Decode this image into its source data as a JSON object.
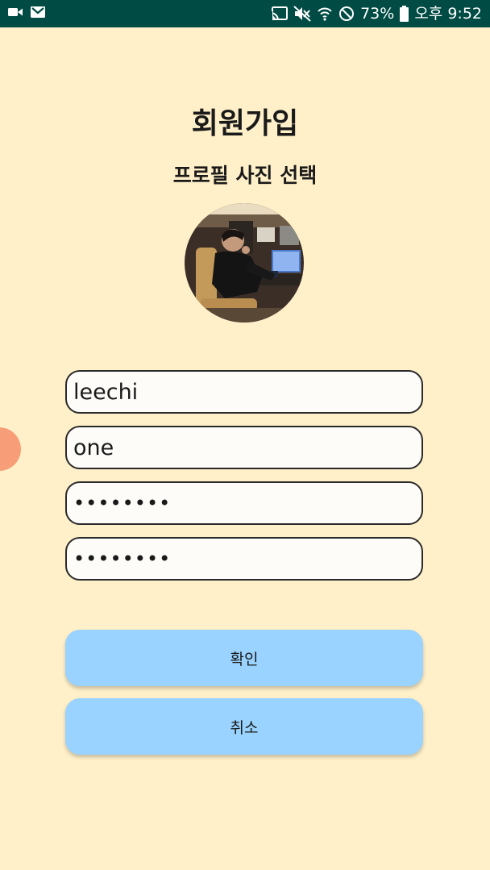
{
  "status_bar": {
    "battery": "73%",
    "time": "오후 9:52",
    "icons_left": [
      "video-icon",
      "gmail-icon"
    ],
    "icons_right": [
      "cast-icon",
      "mute-icon",
      "wifi-icon",
      "block-icon",
      "battery-icon"
    ]
  },
  "header": {
    "title": "회원가입",
    "subtitle": "프로필 사진 선택"
  },
  "form": {
    "name_value": "leechi",
    "id_value": "one",
    "password_value": "••••••••",
    "password_confirm_value": "••••••••"
  },
  "buttons": {
    "confirm_label": "확인",
    "cancel_label": "취소"
  },
  "colors": {
    "background": "#fff0c9",
    "status_bar": "#004b43",
    "button": "#9ad3ff",
    "side_bubble": "#f79d78"
  }
}
